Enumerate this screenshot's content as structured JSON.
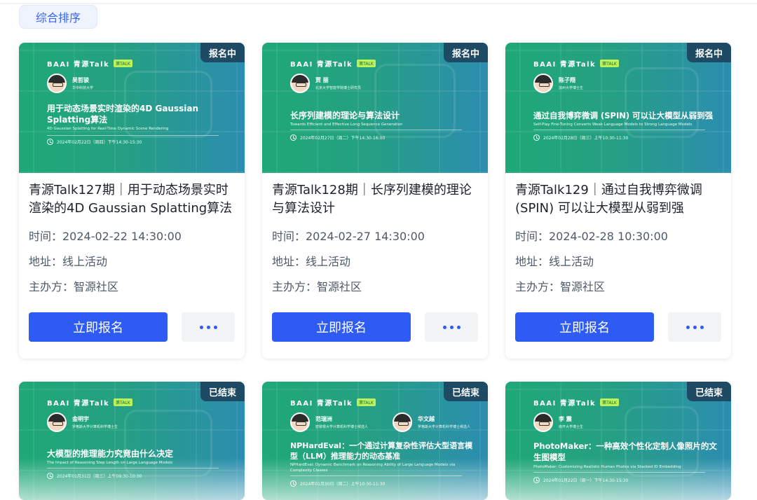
{
  "sort": {
    "label": "综合排序"
  },
  "brand": {
    "name": "BAAI 青源Talk",
    "badge": "第TALK"
  },
  "cards": [
    {
      "status": "报名中",
      "speakers": [
        {
          "name": "吴哲骏",
          "affiliation": "华中科技大学"
        }
      ],
      "banner_title": "用于动态场景实时渲染的4D Gaussian Splatting算法",
      "banner_subtitle": "4D Gaussian Splatting for Real-Time Dynamic Scene Rendering",
      "banner_time": "2024年02月22日（周四）下午14:30-15:30",
      "title": "青源Talk127期｜用于动态场景实时渲染的4D Gaussian Splatting算法",
      "time": "时间：2024-02-22 14:30:00",
      "address": "地址：线上活动",
      "organizer": "主办方：智源社区",
      "register_label": "立即报名"
    },
    {
      "status": "报名中",
      "speakers": [
        {
          "name": "贾 丽",
          "affiliation": "北京大学智能学院博士研究员"
        }
      ],
      "banner_title": "长序列建模的理论与算法设计",
      "banner_subtitle": "Towards Efficient and Effective Long Sequence Generation",
      "banner_time": "2024年02月27日（周二）下午14:30-16:00",
      "title": "青源Talk128期｜长序列建模的理论与算法设计",
      "time": "时间：2024-02-27 14:30:00",
      "address": "地址：线上活动",
      "organizer": "主办方：智源社区",
      "register_label": "立即报名"
    },
    {
      "status": "报名中",
      "speakers": [
        {
          "name": "陈子翔",
          "affiliation": "加州大学博士生"
        }
      ],
      "banner_title": "通过自我博弈微调 (SPIN) 可以让大模型从弱到强",
      "banner_subtitle": "Self-Play Fine-Tuning Converts Weak Language Models to Strong Language Models",
      "banner_time": "2024年02月28日（周三）上午10:30-11:30",
      "title": "青源Talk129｜通过自我博弈微调 (SPIN) 可以让大模型从弱到强",
      "time": "时间：2024-02-28 10:30:00",
      "address": "地址：线上活动",
      "organizer": "主办方：智源社区",
      "register_label": "立即报名"
    },
    {
      "status": "已结束",
      "speakers": [
        {
          "name": "金明宇",
          "affiliation": "罗格斯大学计算机科学博士生"
        }
      ],
      "banner_title": "大模型的推理能力究竟由什么决定",
      "banner_subtitle": "The Impact of Reasoning Step Length on Large Language Models",
      "banner_time": "2024年01月31日（周三）上午09:30-10:30"
    },
    {
      "status": "已结束",
      "speakers": [
        {
          "name": "范瑞洲",
          "affiliation": "密歇根大学计算机科学博士候选人"
        },
        {
          "name": "华文越",
          "affiliation": "罗格斯大学计算机科学博士候选人"
        }
      ],
      "banner_title": "NPHardEval：一个通过计算复杂性评估大型语言模型（LLM）推理能力的动态基准",
      "banner_subtitle": "NPHardEval: Dynamic Benchmark on Reasoning Ability of Large Language Models via Complexity Classes",
      "banner_time": "2024年01月30日（周二）上午10:30-11:30"
    },
    {
      "status": "已结束",
      "speakers": [
        {
          "name": "李 震",
          "affiliation": "南开大学博士生"
        }
      ],
      "banner_title": "PhotoMaker：一种高效个性化定制人像照片的文生图模型",
      "banner_subtitle": "PhotoMaker: Customizing Realistic Human Photos via Stacked ID Embedding",
      "banner_time": "2024年01月22日（周一）下午14:30-15:30"
    }
  ]
}
